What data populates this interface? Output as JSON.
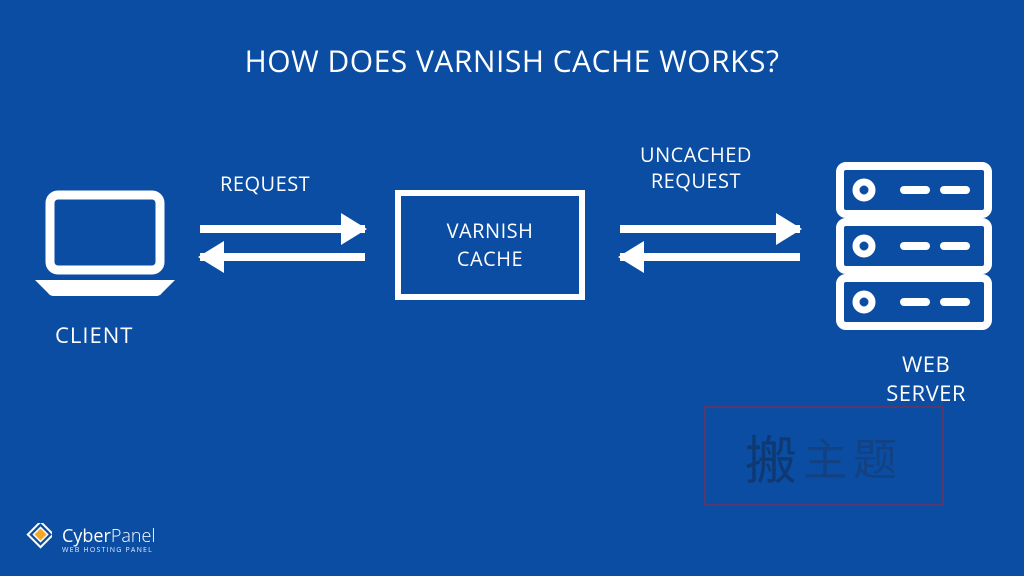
{
  "title": "HOW DOES VARNISH CACHE WORKS?",
  "nodes": {
    "client_label": "CLIENT",
    "varnish_line1": "VARNISH",
    "varnish_line2": "CACHE",
    "server_line1": "WEB",
    "server_line2": "SERVER"
  },
  "arrows": {
    "left_top_label": "REQUEST",
    "right_top_line1": "UNCACHED",
    "right_top_line2": "REQUEST"
  },
  "footer": {
    "brand_strong": "Cyber",
    "brand_light": "Panel",
    "tagline": "WEB HOSTING PANEL"
  },
  "watermark": {
    "char1": "搬",
    "char2": "主题"
  },
  "colors": {
    "background": "#0b4da2",
    "foreground": "#ffffff"
  }
}
